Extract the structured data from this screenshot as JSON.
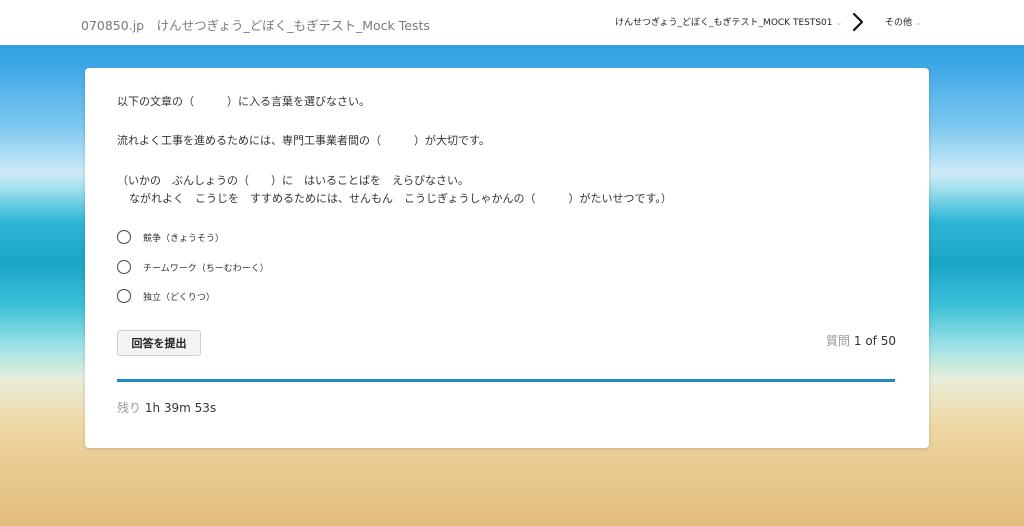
{
  "header": {
    "site_title": "070850.jp　けんせつぎょう_どぼく_もぎテスト_Mock Tests",
    "nav_test": "けんせつぎょう_どぼく_もぎテスト_MOCK TESTS01",
    "nav_other": "その他",
    "caret": "⌄"
  },
  "question": {
    "line1": "以下の文章の（　　　）に入る言葉を選びなさい。",
    "line2": "流れよく工事を進めるためには、専門工事業者間の（　　　）が大切です。",
    "line3": "（いかの　ぶんしょうの（　　）に　はいることばを　えらびなさい。",
    "line4": "ながれよく　こうじを　すすめるためには、せんもん　こうじぎょうしゃかんの（　　　）がたいせつです。）"
  },
  "options": [
    {
      "label": "競争（きょうそう）"
    },
    {
      "label": "チームワーク（ちーむわーく）"
    },
    {
      "label": "独立（どくりつ）"
    }
  ],
  "submit_label": "回答を提出",
  "counter": {
    "prefix": "質問",
    "value": "1 of 50"
  },
  "progress": {
    "fraction": 1.0
  },
  "remaining": {
    "prefix": "残り",
    "time": "1h 39m 53s"
  },
  "colors": {
    "accent": "#1f89c3"
  }
}
